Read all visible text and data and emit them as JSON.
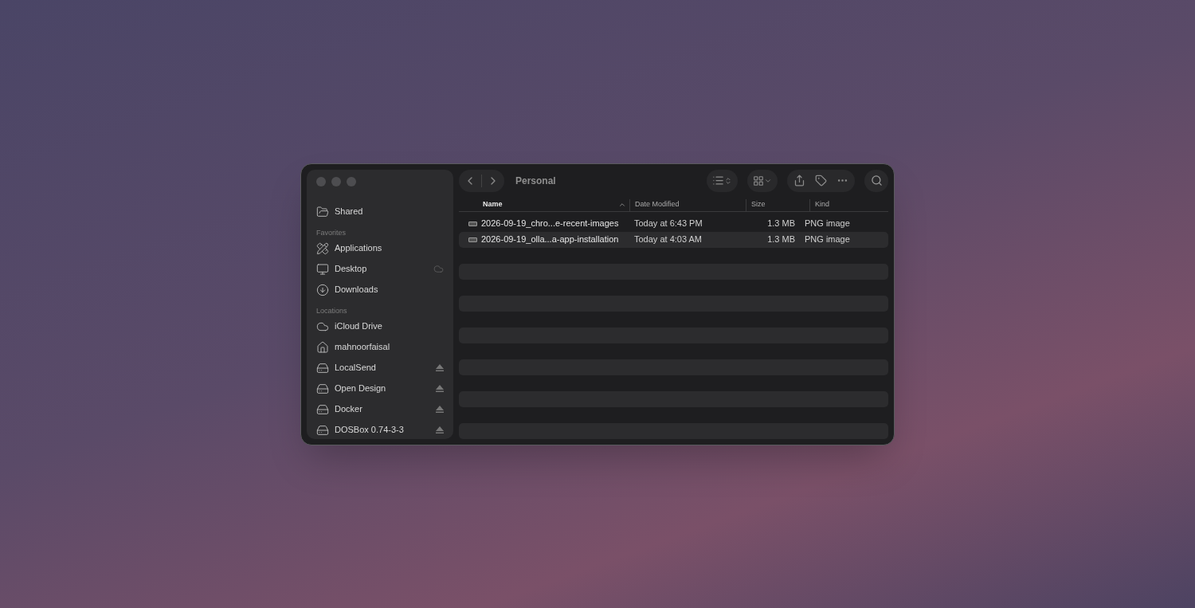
{
  "window": {
    "title": "Personal"
  },
  "sidebar": {
    "top_items": [
      {
        "label": "Shared",
        "kind": "shared",
        "ejectable": false,
        "in_icloud": false
      }
    ],
    "sections": [
      {
        "heading": "Favorites",
        "items": [
          {
            "label": "Applications",
            "kind": "applications",
            "ejectable": false,
            "in_icloud": false
          },
          {
            "label": "Desktop",
            "kind": "desktop",
            "ejectable": false,
            "in_icloud": true
          },
          {
            "label": "Downloads",
            "kind": "downloads",
            "ejectable": false,
            "in_icloud": false
          }
        ]
      },
      {
        "heading": "Locations",
        "items": [
          {
            "label": "iCloud Drive",
            "kind": "icloud",
            "ejectable": false,
            "in_icloud": false
          },
          {
            "label": "mahnoorfaisal",
            "kind": "home",
            "ejectable": false,
            "in_icloud": false
          },
          {
            "label": "LocalSend",
            "kind": "volume",
            "ejectable": true,
            "in_icloud": false
          },
          {
            "label": "Open Design",
            "kind": "volume",
            "ejectable": true,
            "in_icloud": false
          },
          {
            "label": "Docker",
            "kind": "volume",
            "ejectable": true,
            "in_icloud": false
          },
          {
            "label": "DOSBox 0.74-3-3",
            "kind": "volume",
            "ejectable": true,
            "in_icloud": false
          }
        ]
      }
    ]
  },
  "table": {
    "columns": [
      {
        "label": "Name",
        "sorted": true
      },
      {
        "label": "Date Modified",
        "sorted": false
      },
      {
        "label": "Size",
        "sorted": false
      },
      {
        "label": "Kind",
        "sorted": false
      }
    ],
    "rows": [
      {
        "name": "2026-09-19_chro...e-recent-images",
        "date": "Today at 6:43 PM",
        "size": "1.3 MB",
        "kind": "PNG image"
      },
      {
        "name": "2026-09-19_olla...a-app-installation",
        "date": "Today at 4:03 AM",
        "size": "1.3 MB",
        "kind": "PNG image"
      }
    ]
  }
}
